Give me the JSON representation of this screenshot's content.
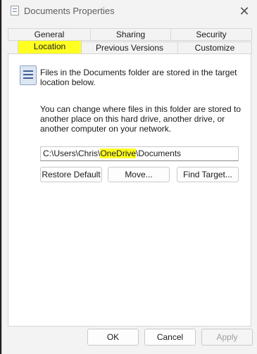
{
  "window": {
    "title": "Documents Properties",
    "close_glyph": "✕",
    "icon": "document-properties-icon"
  },
  "tabs": {
    "row1": [
      "General",
      "Sharing",
      "Security"
    ],
    "row2": [
      "Location",
      "Previous Versions",
      "Customize"
    ],
    "active": "Location",
    "highlight_color": "#ffff22"
  },
  "location": {
    "info_text": "Files in the Documents folder are stored in the target location below.",
    "desc_text": "You can change where files in this folder are stored to another place on this hard drive, another drive, or another computer on your network.",
    "path_prefix": "C:\\Users\\Chris\\",
    "path_highlight": "OneDrive",
    "path_suffix": "\\Documents",
    "buttons": {
      "restore_default": "Restore Default",
      "move": "Move...",
      "find_target": "Find Target..."
    }
  },
  "footer": {
    "ok": "OK",
    "cancel": "Cancel",
    "apply": "Apply"
  }
}
